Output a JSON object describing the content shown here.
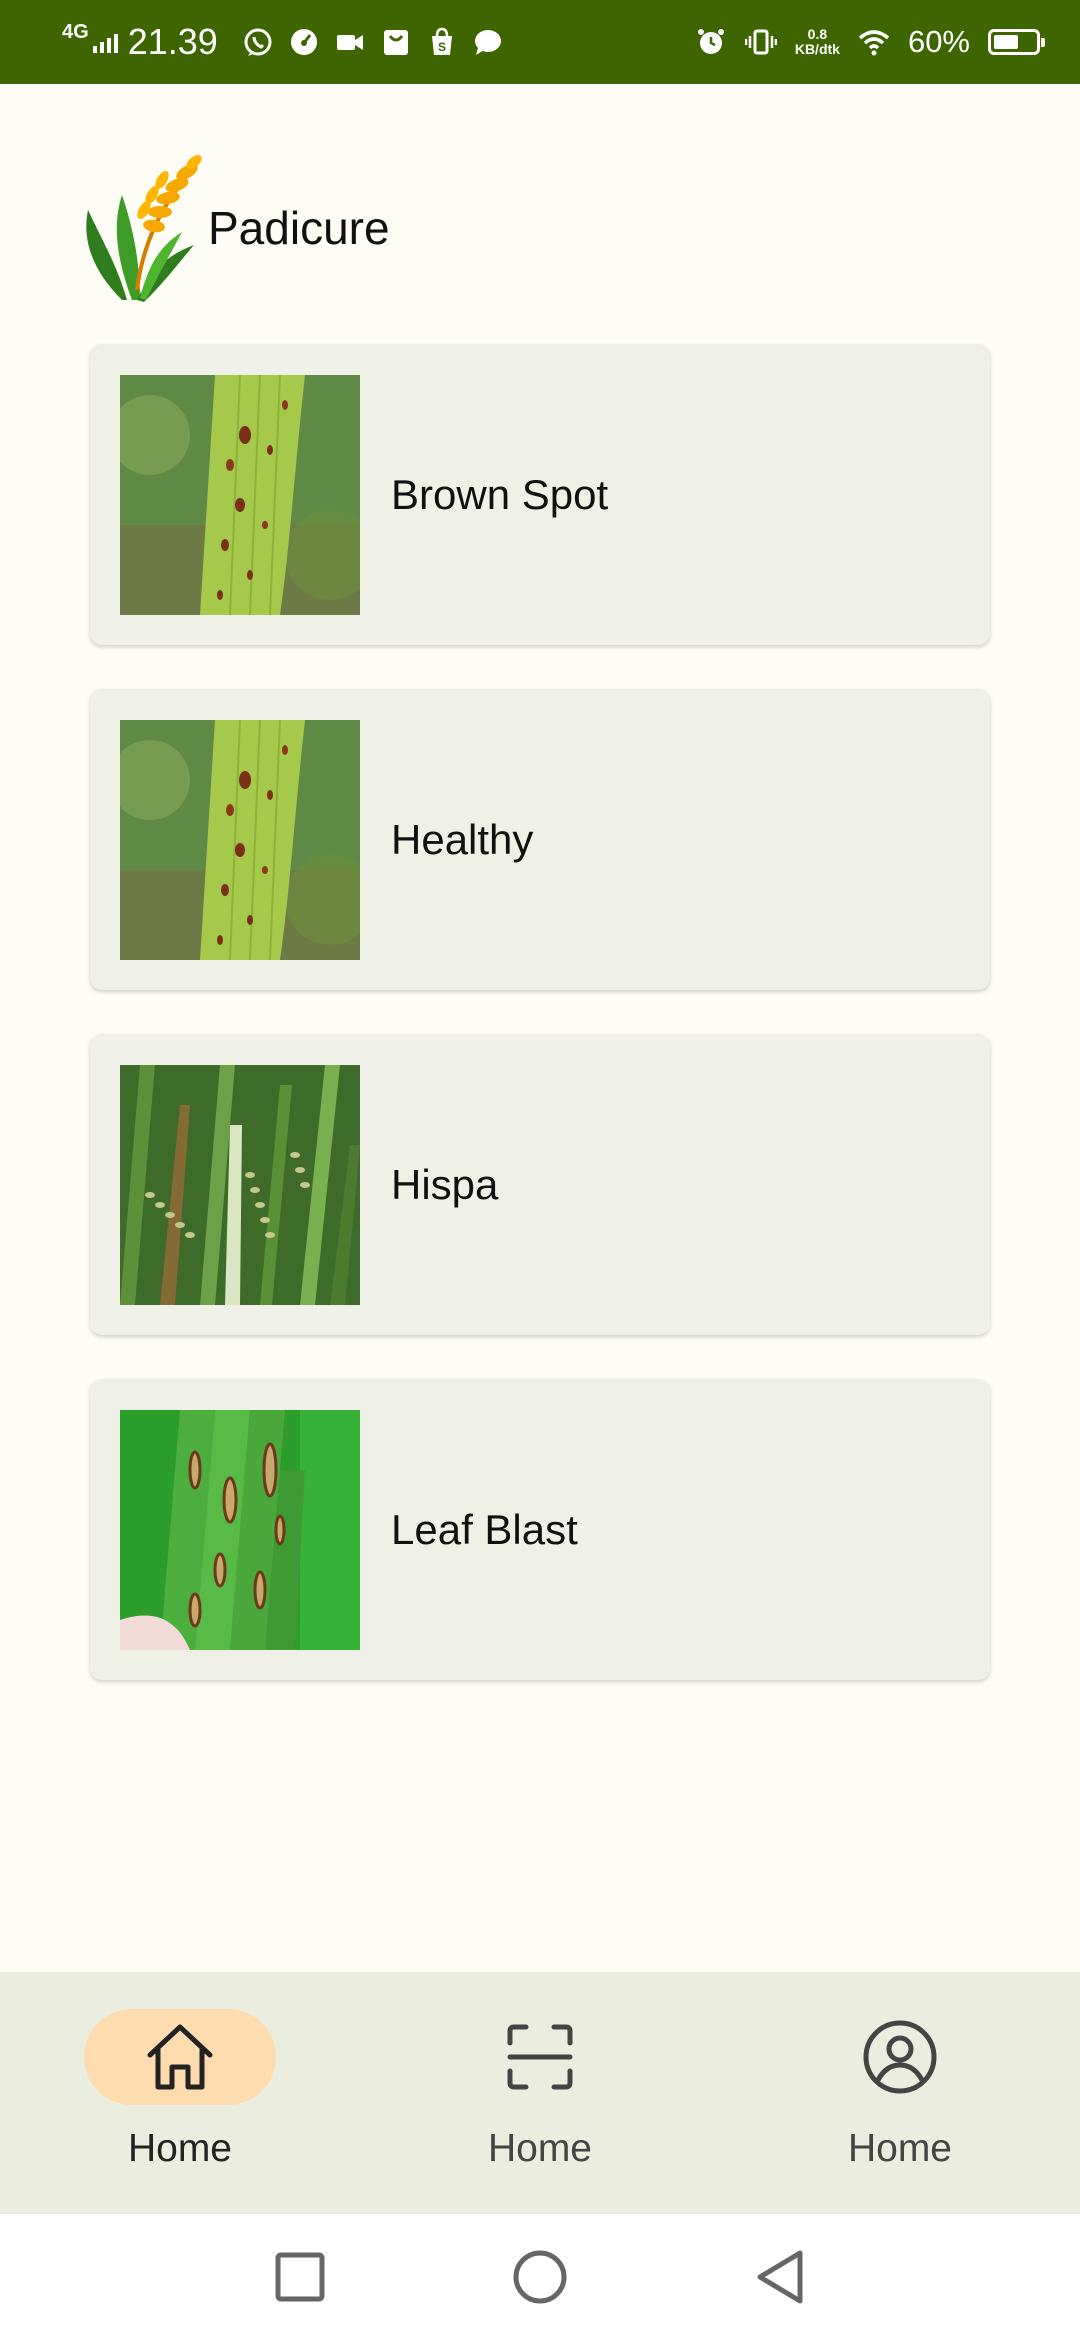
{
  "status_bar": {
    "network": "4G",
    "time": "21.39",
    "net_speed_value": "0.8",
    "net_speed_unit": "KB/dtk",
    "battery_percent": "60%",
    "battery_level": 0.6,
    "icons_left": [
      "whatsapp-icon",
      "speedometer-icon",
      "video-call-icon",
      "shopping-bag-icon",
      "shop-icon",
      "chat-icon"
    ],
    "icons_right": [
      "alarm-icon",
      "vibrate-icon",
      "wifi-icon",
      "battery-icon"
    ]
  },
  "header": {
    "title": "Padicure",
    "logo_icon": "rice-plant-icon"
  },
  "diseases": [
    {
      "label": "Brown Spot"
    },
    {
      "label": "Healthy"
    },
    {
      "label": "Hispa"
    },
    {
      "label": "Leaf Blast"
    }
  ],
  "bottom_nav": {
    "items": [
      {
        "label": "Home",
        "icon": "home-icon",
        "active": true
      },
      {
        "label": "Home",
        "icon": "scan-icon",
        "active": false
      },
      {
        "label": "Home",
        "icon": "profile-icon",
        "active": false
      }
    ]
  },
  "colors": {
    "status_bar": "#3d6600",
    "background": "#fdfdf5",
    "card": "#f0f1e6",
    "nav_bar": "#ebeddf",
    "nav_active_pill": "#ffdcaf"
  }
}
